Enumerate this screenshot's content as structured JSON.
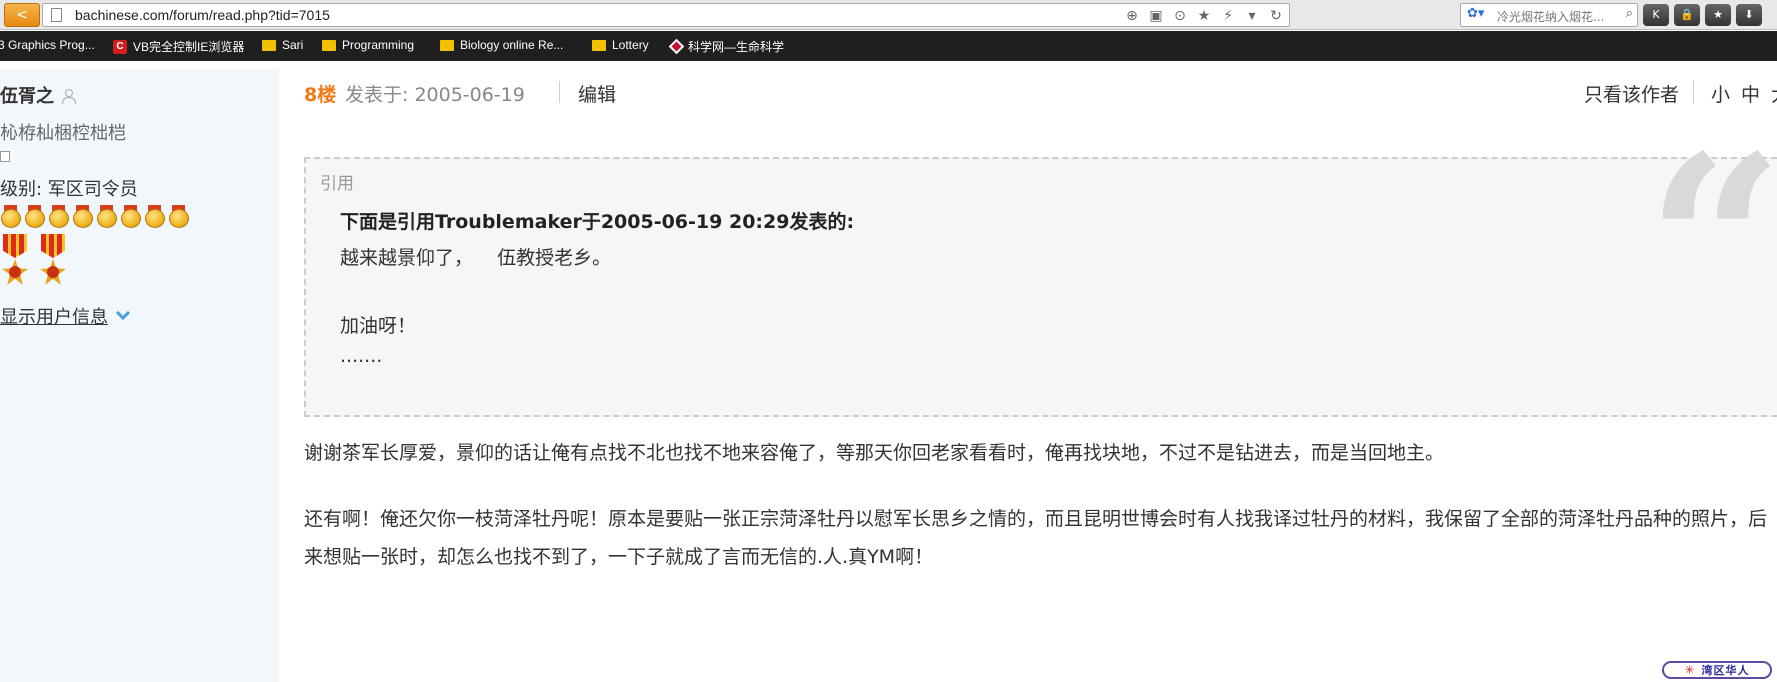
{
  "browser": {
    "back_symbol": "<",
    "url": "bachinese.com/forum/read.php?tid=7015",
    "url_tools": [
      "⊕",
      "▣",
      "⊙",
      "★",
      "⚡",
      "▾",
      "↻"
    ],
    "search_text": "冷光烟花纳入烟花...",
    "search_engine_symbol": "✿▾",
    "search_icon_symbol": "⌕",
    "ext_buttons": [
      "K",
      "🔒",
      "★",
      "⬇"
    ]
  },
  "bookmarks": [
    {
      "label": "3 Graphics Prog...",
      "icon": "none"
    },
    {
      "label": "VB完全控制IE浏览器",
      "icon": "c-logo"
    },
    {
      "label": "Sari",
      "icon": "folder"
    },
    {
      "label": "Programming",
      "icon": "folder"
    },
    {
      "label": "Biology online Re...",
      "icon": "folder"
    },
    {
      "label": "Lottery",
      "icon": "folder"
    },
    {
      "label": "科学网—生命科学",
      "icon": "diamond"
    }
  ],
  "sidebar": {
    "username": "伍胥之",
    "usertitle": "杺栫杣梱椌柮桤",
    "level": "级别: 军区司令员",
    "medal_count": 8,
    "badge_count": 2,
    "show_info": "显示用户信息"
  },
  "post": {
    "floor": "8楼",
    "posted": "发表于: 2005-06-19",
    "edit": "编辑",
    "only_author": "只看该作者",
    "font_sizes": [
      "小",
      "中",
      "大"
    ]
  },
  "quote": {
    "label": "引用",
    "author_line": "下面是引用Troublemaker于2005-06-19 20:29发表的:",
    "lines": [
      "越来越景仰了，    伍教授老乡。",
      "",
      "加油呀！",
      "......."
    ]
  },
  "body": {
    "paragraphs": [
      "谢谢茶军长厚爱，景仰的话让俺有点找不北也找不地来容俺了，等那天你回老家看看时，俺再找块地，不过不是钻进去，而是当回地主。",
      "还有啊！俺还欠你一枝菏泽牡丹呢！原本是要贴一张正宗菏泽牡丹以慰军长思乡之情的，而且昆明世博会时有人找我译过牡丹的材料，我保留了全部的菏泽牡丹品种的照片，后来想贴一张时，却怎么也找不到了，一下子就成了言而无信的.人.真YM啊！"
    ]
  },
  "site_logo": "湾区华人",
  "colors": {
    "floor": "#ee7b1a",
    "sidebar_bg": "#f2f7fc",
    "quote_bg": "#f6f6f6",
    "bookmarks_bg": "#1f1f1f"
  }
}
